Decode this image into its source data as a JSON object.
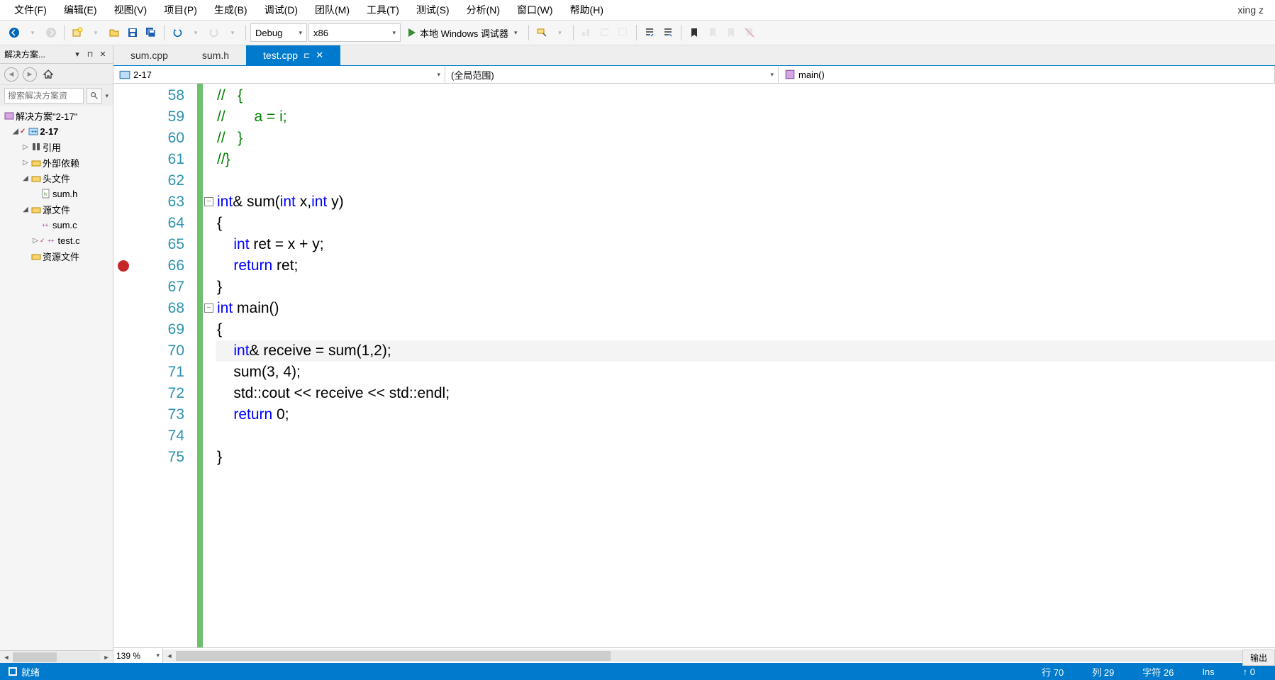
{
  "menubar": {
    "items": [
      "文件(F)",
      "编辑(E)",
      "视图(V)",
      "项目(P)",
      "生成(B)",
      "调试(D)",
      "团队(M)",
      "工具(T)",
      "测试(S)",
      "分析(N)",
      "窗口(W)",
      "帮助(H)"
    ],
    "user": "xing z"
  },
  "toolbar": {
    "config": "Debug",
    "platform": "x86",
    "run_label": "本地 Windows 调试器"
  },
  "solution_explorer": {
    "title": "解决方案...",
    "search_placeholder": "搜索解决方案资",
    "nodes": {
      "solution": "解决方案\"2-17\"",
      "project": "2-17",
      "refs": "引用",
      "external": "外部依赖",
      "headers": "头文件",
      "header_file": "sum.h",
      "sources": "源文件",
      "source1": "sum.c",
      "source2": "test.c",
      "resources": "资源文件"
    }
  },
  "tabs": {
    "t1": "sum.cpp",
    "t2": "sum.h",
    "t3": "test.cpp"
  },
  "nav": {
    "project": "2-17",
    "scope": "(全局范围)",
    "func": "main()"
  },
  "code": {
    "lines": [
      {
        "n": 58,
        "html": "<span class='c-comment'>//   {</span>"
      },
      {
        "n": 59,
        "html": "<span class='c-comment'>//       a = i;</span>"
      },
      {
        "n": 60,
        "html": "<span class='c-comment'>//   }</span>"
      },
      {
        "n": 61,
        "html": "<span class='c-comment'>//}</span>"
      },
      {
        "n": 62,
        "html": ""
      },
      {
        "n": 63,
        "html": "<span class='c-kw'>int</span>&amp; sum(<span class='c-kw'>int</span> x,<span class='c-kw'>int</span> y)",
        "fold": true
      },
      {
        "n": 64,
        "html": "{"
      },
      {
        "n": 65,
        "html": "    <span class='c-kw'>int</span> ret = x + y;"
      },
      {
        "n": 66,
        "html": "    <span class='c-kw'>return</span> ret;",
        "bp": true
      },
      {
        "n": 67,
        "html": "}"
      },
      {
        "n": 68,
        "html": "<span class='c-kw'>int</span> main()",
        "fold": true
      },
      {
        "n": 69,
        "html": "{"
      },
      {
        "n": 70,
        "html": "    <span class='c-kw'>int</span>&amp; receive = sum(1,2);",
        "current": true
      },
      {
        "n": 71,
        "html": "    sum(3, 4);"
      },
      {
        "n": 72,
        "html": "    std::cout &lt;&lt; receive &lt;&lt; std::endl;"
      },
      {
        "n": 73,
        "html": "    <span class='c-kw'>return</span> 0;"
      },
      {
        "n": 74,
        "html": ""
      },
      {
        "n": 75,
        "html": "}"
      }
    ],
    "zoom": "139 %"
  },
  "output_tab": "输出",
  "status": {
    "ready": "就绪",
    "line": "行 70",
    "col": "列 29",
    "char": "字符 26",
    "ins": "Ins",
    "pub": "↑  0"
  }
}
